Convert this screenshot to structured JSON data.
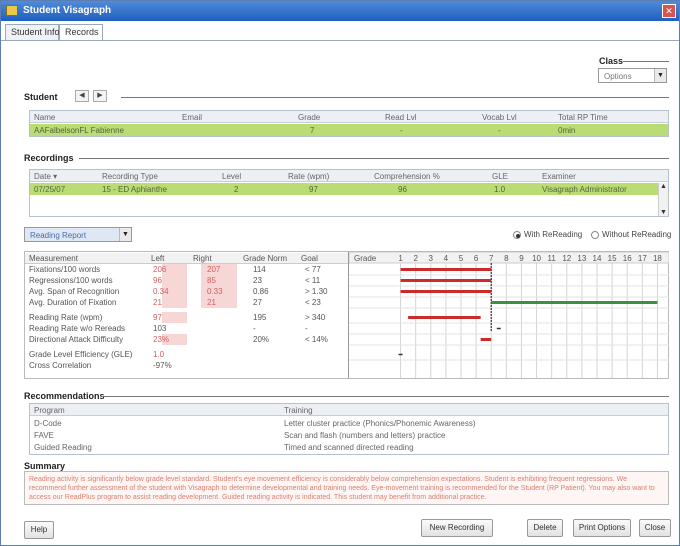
{
  "window": {
    "title": "Student Visagraph"
  },
  "tabs": [
    "Student Info",
    "Records"
  ],
  "class_section": {
    "label": "Class",
    "select_value": "Options"
  },
  "student": {
    "section_label": "Student",
    "headers": [
      "Name",
      "Email",
      "Grade",
      "Read Lvl",
      "Vocab Lvl",
      "Total RP Time"
    ],
    "row": [
      "AAFalbelsonFL Fabienne",
      "",
      "7",
      "-",
      "-",
      "0min"
    ]
  },
  "recordings": {
    "section_label": "Recordings",
    "headers": [
      "Date ▾",
      "Recording Type",
      "Level",
      "Rate (wpm)",
      "Comprehension %",
      "GLE",
      "Examiner"
    ],
    "row": [
      "07/25/07",
      "15 - ED Aphianthe",
      "2",
      "97",
      "96",
      "1.0",
      "Visagraph Administrator"
    ]
  },
  "report": {
    "select_value": "Reading Report",
    "radio_with": "With ReReading",
    "radio_without": "Without ReReading",
    "headers": [
      "Measurement",
      "Left",
      "Right",
      "Grade Norm",
      "Goal"
    ],
    "rows": [
      [
        "Fixations/100 words",
        "206",
        "207",
        "114",
        "< 77"
      ],
      [
        "Regressions/100 words",
        "96",
        "85",
        "23",
        "< 11"
      ],
      [
        "Avg. Span of Recognition",
        "0.34",
        "0.33",
        "0.86",
        "> 1.30"
      ],
      [
        "Avg. Duration of Fixation",
        "21",
        "21",
        "27",
        "< 23"
      ],
      [
        "Reading Rate (wpm)",
        "97",
        "",
        "195",
        "> 340"
      ],
      [
        "Reading Rate w/o Rereads",
        "103",
        "",
        "-",
        "-"
      ],
      [
        "Directional Attack Difficulty",
        "23%",
        "",
        "20%",
        "< 14%"
      ],
      [
        "Grade Level Efficiency (GLE)",
        "1.0",
        "",
        "",
        ""
      ],
      [
        "Cross Correlation",
        "-97%",
        "",
        "",
        ""
      ]
    ],
    "chart_grade_label": "Grade",
    "grade_ticks": [
      "1",
      "2",
      "3",
      "4",
      "5",
      "6",
      "7",
      "8",
      "9",
      "10",
      "11",
      "12",
      "13",
      "14",
      "15",
      "16",
      "17",
      "18"
    ]
  },
  "chart_data": {
    "type": "bar",
    "title": "",
    "x_label": "Grade",
    "xlim": [
      1,
      18
    ],
    "categories": [
      "Fixations/100 words",
      "Regressions/100 words",
      "Avg. Span of Recognition",
      "Avg. Duration of Fixation",
      "Reading Rate (wpm)",
      "Reading Rate w/o Rereads",
      "Directional Attack Difficulty",
      "Grade Level Efficiency (GLE)"
    ],
    "grade_norm_line": 7,
    "series": [
      {
        "color": "#cc2b2b",
        "bars": [
          {
            "row": 0,
            "from": 1,
            "to": 7
          },
          {
            "row": 1,
            "from": 1,
            "to": 7
          },
          {
            "row": 2,
            "from": 1,
            "to": 7
          },
          {
            "row": 4,
            "from": 1.5,
            "to": 6.3
          },
          {
            "row": 6,
            "from": 6.3,
            "to": 7
          }
        ]
      },
      {
        "color": "#3f8f3f",
        "bars": [
          {
            "row": 3,
            "from": 7,
            "to": 18
          }
        ]
      }
    ],
    "ticks": [
      {
        "row": 5,
        "at": 7.5
      },
      {
        "row": 7,
        "at": 1
      }
    ]
  },
  "recommendations": {
    "section_label": "Recommendations",
    "headers": [
      "Program",
      "Training"
    ],
    "rows": [
      [
        "D-Code",
        "Letter cluster practice (Phonics/Phonemic Awareness)"
      ],
      [
        "FAVE",
        "Scan and flash (numbers and letters) practice"
      ],
      [
        "Guided Reading",
        "Timed and scanned directed reading"
      ]
    ]
  },
  "summary": {
    "section_label": "Summary",
    "text": "Reading activity is significantly below grade level standard. Student's eye movement efficiency is considerably below comprehension expectations. Student is exhibiting frequent regressions. We recommend further assessment of the student with Visagraph to determine developmental and training needs. Eye-movement training is recommended for the Student (RP Patient). You may also want to access our ReadPlus program to assist reading development. Guided reading activity is indicated. This student may benefit from additional practice."
  },
  "buttons": {
    "help": "Help",
    "new_recording": "New Recording",
    "delete": "Delete",
    "print_options": "Print Options",
    "close": "Close"
  },
  "colors": {
    "title_bar": "#2a6ac8",
    "row_highlight": "#b9dc74",
    "bar_red": "#cc2b2b",
    "bar_green": "#3f8f3f"
  }
}
